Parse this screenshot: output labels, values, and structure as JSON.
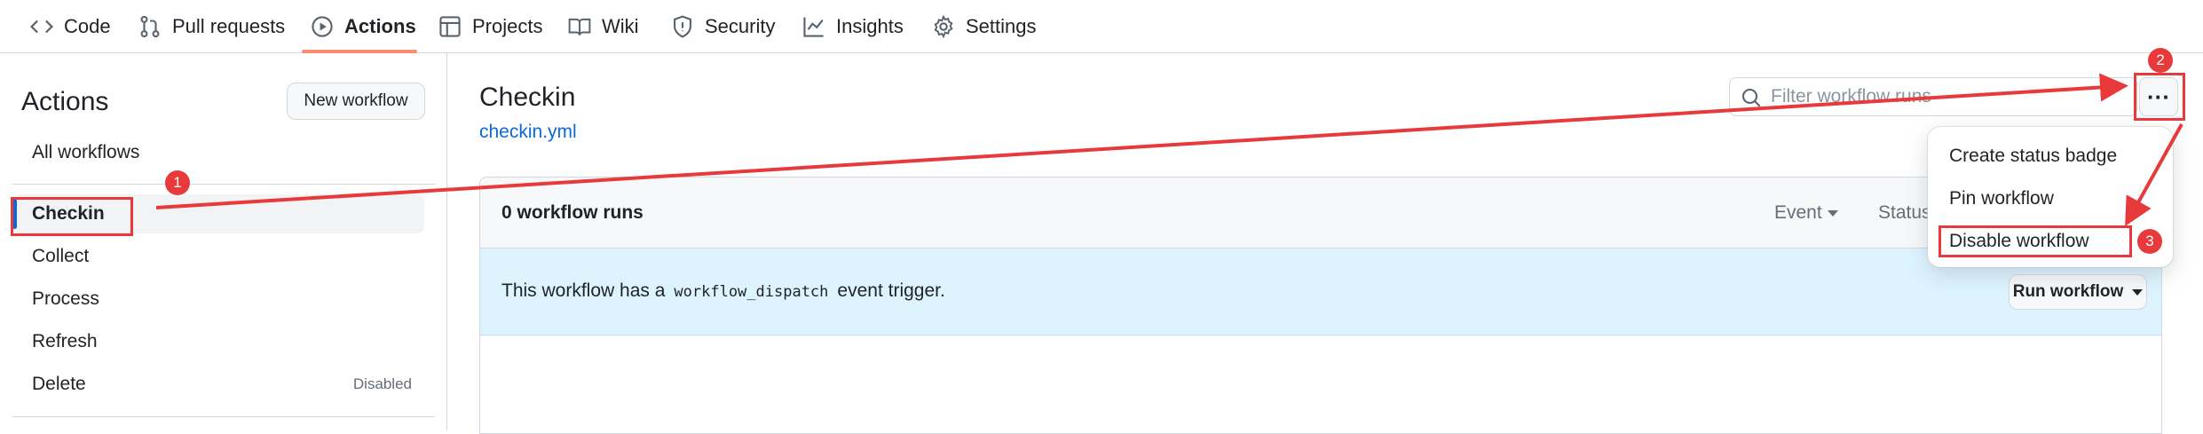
{
  "nav": {
    "tabs": [
      {
        "label": "Code",
        "icon": "code-icon"
      },
      {
        "label": "Pull requests",
        "icon": "pull-request-icon"
      },
      {
        "label": "Actions",
        "icon": "play-icon"
      },
      {
        "label": "Projects",
        "icon": "table-icon"
      },
      {
        "label": "Wiki",
        "icon": "book-icon"
      },
      {
        "label": "Security",
        "icon": "shield-icon"
      },
      {
        "label": "Insights",
        "icon": "graph-icon"
      },
      {
        "label": "Settings",
        "icon": "gear-icon"
      }
    ],
    "selected": "Actions",
    "accent": "#fd8c73"
  },
  "sidebar": {
    "title": "Actions",
    "new_workflow": "New workflow",
    "all_workflows": "All workflows",
    "items": [
      {
        "label": "Checkin",
        "active": true
      },
      {
        "label": "Collect"
      },
      {
        "label": "Process"
      },
      {
        "label": "Refresh"
      },
      {
        "label": "Delete",
        "badge": "Disabled"
      }
    ]
  },
  "main": {
    "title": "Checkin",
    "file_link": "checkin.yml",
    "filter_placeholder": "Filter workflow runs",
    "kebab": "···",
    "runs_count": "0 workflow runs",
    "event_filter": "Event",
    "status_filter": "Status",
    "banner_prefix": "This workflow has a",
    "banner_code": "workflow_dispatch",
    "banner_suffix": "event trigger.",
    "run_workflow": "Run workflow"
  },
  "menu": {
    "items": [
      "Create status badge",
      "Pin workflow",
      "Disable workflow"
    ]
  },
  "annotations": {
    "color": "#e8393b",
    "numbers": [
      "1",
      "2",
      "3"
    ]
  }
}
